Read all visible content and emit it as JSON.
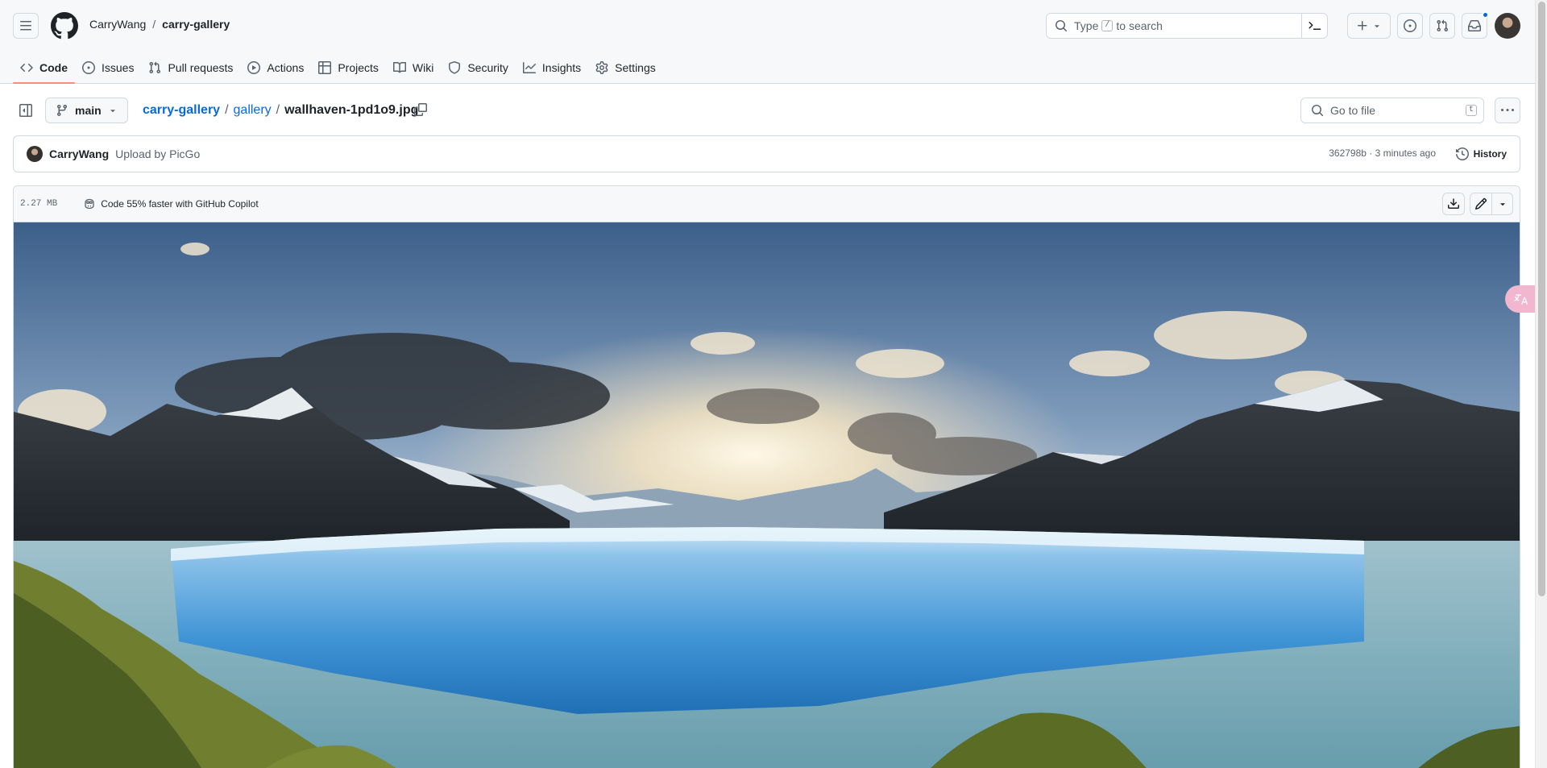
{
  "header": {
    "owner": "CarryWang",
    "separator": "/",
    "repo": "carry-gallery",
    "search_placeholder_pre": "Type",
    "search_kbd": "/",
    "search_placeholder_post": "to search"
  },
  "tabs": [
    {
      "label": "Code",
      "icon": "code-icon",
      "active": true
    },
    {
      "label": "Issues",
      "icon": "issue-opened-icon"
    },
    {
      "label": "Pull requests",
      "icon": "git-pull-request-icon"
    },
    {
      "label": "Actions",
      "icon": "play-icon"
    },
    {
      "label": "Projects",
      "icon": "table-icon"
    },
    {
      "label": "Wiki",
      "icon": "book-icon"
    },
    {
      "label": "Security",
      "icon": "shield-icon"
    },
    {
      "label": "Insights",
      "icon": "graph-icon"
    },
    {
      "label": "Settings",
      "icon": "gear-icon"
    }
  ],
  "file_header": {
    "branch": "main",
    "breadcrumb": [
      "carry-gallery",
      "gallery"
    ],
    "crumb_sep": "/",
    "filename": "wallhaven-1pd1o9.jpg",
    "goto_placeholder": "Go to file",
    "goto_kbd": "t"
  },
  "commit": {
    "author": "CarryWang",
    "message": "Upload by PicGo",
    "meta": "362798b · 3 minutes ago",
    "history_label": "History"
  },
  "blob": {
    "size": "2.27 MB",
    "copilot_text": "Code 55% faster with GitHub Copilot"
  },
  "colors": {
    "accent": "#0969da",
    "tab_underline": "#fd8c73",
    "border": "#d1d9e0",
    "header_bg": "#f6f8fa"
  },
  "translate_fab_icon": "translate-icon"
}
